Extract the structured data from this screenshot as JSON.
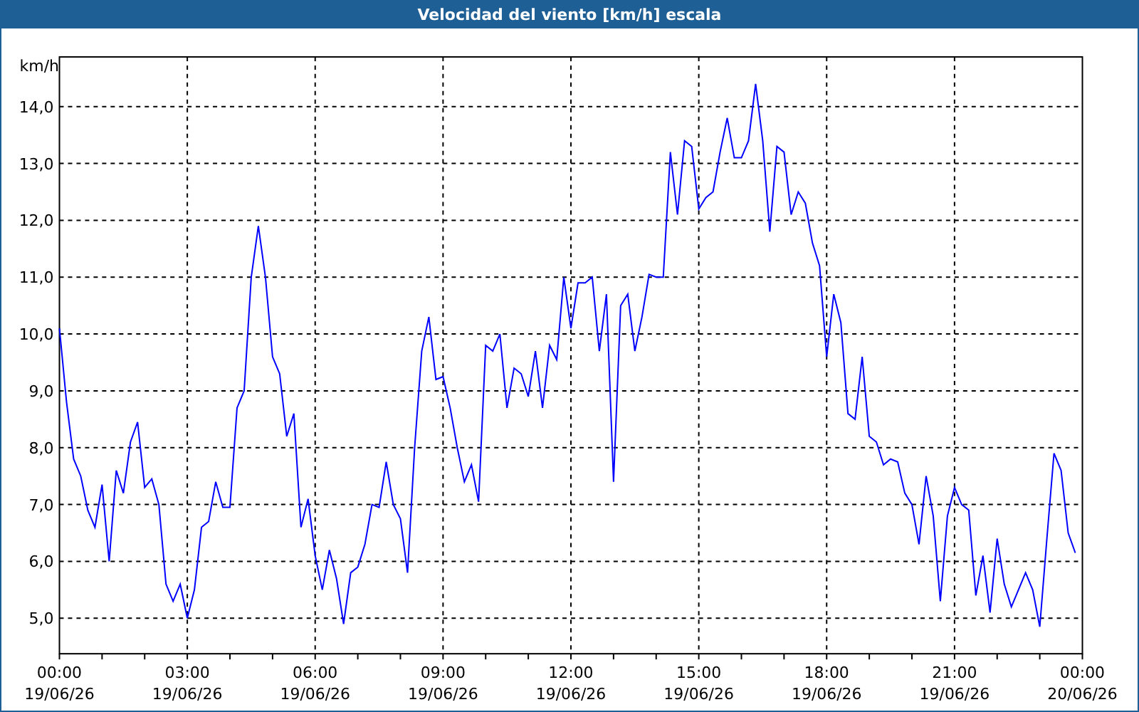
{
  "window": {
    "title": "Velocidad del viento [km/h] escala"
  },
  "chart_data": {
    "type": "line",
    "ylabel": "km/h",
    "grid": true,
    "categories": [
      "00:00 19/06/26",
      null,
      null,
      null,
      null,
      null,
      null,
      null,
      null,
      null,
      null,
      null,
      null,
      null,
      null,
      null,
      null,
      null,
      "03:00 19/06/26",
      null,
      null,
      null,
      null,
      null,
      null,
      null,
      null,
      null,
      null,
      null,
      null,
      null,
      null,
      null,
      null,
      null,
      "06:00 19/06/26",
      null,
      null,
      null,
      null,
      null,
      null,
      null,
      null,
      null,
      null,
      null,
      null,
      null,
      null,
      null,
      null,
      null,
      "09:00 19/06/26",
      null,
      null,
      null,
      null,
      null,
      null,
      null,
      null,
      null,
      null,
      null,
      null,
      null,
      null,
      null,
      null,
      null,
      "12:00 19/06/26",
      null,
      null,
      null,
      null,
      null,
      null,
      null,
      null,
      null,
      null,
      null,
      null,
      null,
      null,
      null,
      null,
      null,
      "15:00 19/06/26",
      null,
      null,
      null,
      null,
      null,
      null,
      null,
      null,
      null,
      null,
      null,
      null,
      null,
      null,
      null,
      null,
      null,
      "18:00 19/06/26",
      null,
      null,
      null,
      null,
      null,
      null,
      null,
      null,
      null,
      null,
      null,
      null,
      null,
      null,
      null,
      null,
      null,
      "21:00 19/06/26",
      null,
      null,
      null,
      null,
      null,
      null,
      null,
      null,
      null,
      null,
      null,
      null,
      null,
      null,
      null,
      null,
      null,
      "00:00 20/06/26"
    ],
    "series": [
      {
        "color": "#0000ff",
        "values": [
          10.1,
          8.8,
          7.8,
          7.5,
          6.9,
          6.6,
          7.35,
          6.0,
          7.6,
          7.2,
          8.1,
          8.45,
          7.3,
          7.45,
          7.0,
          5.6,
          5.3,
          5.6,
          5.0,
          5.5,
          6.6,
          6.7,
          7.4,
          6.95,
          6.95,
          8.7,
          9.0,
          11.0,
          11.9,
          11.0,
          9.6,
          9.3,
          8.2,
          8.6,
          6.6,
          7.1,
          6.1,
          5.5,
          6.2,
          5.7,
          4.9,
          5.8,
          5.9,
          6.3,
          7.0,
          6.95,
          7.75,
          7.0,
          6.75,
          5.8,
          8.0,
          9.7,
          10.3,
          9.2,
          9.25,
          8.7,
          8.0,
          7.4,
          7.7,
          7.05,
          9.8,
          9.7,
          10.0,
          8.7,
          9.4,
          9.3,
          8.9,
          9.7,
          8.7,
          9.8,
          9.55,
          11.0,
          10.1,
          10.9,
          10.9,
          11.0,
          9.7,
          10.7,
          7.4,
          10.5,
          10.7,
          9.7,
          10.3,
          11.05,
          11.0,
          11.0,
          13.2,
          12.1,
          13.4,
          13.3,
          12.2,
          12.4,
          12.5,
          13.2,
          13.8,
          13.1,
          13.1,
          13.4,
          14.4,
          13.4,
          11.8,
          13.3,
          13.2,
          12.1,
          12.5,
          12.3,
          11.6,
          11.2,
          9.6,
          10.7,
          10.2,
          8.6,
          8.5,
          9.6,
          8.2,
          8.1,
          7.7,
          7.8,
          7.75,
          7.2,
          7.0,
          6.3,
          7.5,
          6.8,
          5.3,
          6.8,
          7.3,
          7.0,
          6.9,
          5.4,
          6.1,
          5.1,
          6.4,
          5.6,
          5.2,
          5.5,
          5.8,
          5.5,
          4.85,
          6.4,
          7.9,
          7.6,
          6.5,
          6.15,
          null
        ]
      }
    ],
    "ylim": [
      4.375,
      14.875
    ],
    "yticks": [
      {
        "value": 5,
        "label": "5,0"
      },
      {
        "value": 6,
        "label": "6,0"
      },
      {
        "value": 7,
        "label": "7,0"
      },
      {
        "value": 8,
        "label": "8,0"
      },
      {
        "value": 9,
        "label": "9,0"
      },
      {
        "value": 10,
        "label": "10,0"
      },
      {
        "value": 11,
        "label": "11,0"
      },
      {
        "value": 12,
        "label": "12,0"
      },
      {
        "value": 13,
        "label": "13,0"
      },
      {
        "value": 14,
        "label": "14,0"
      }
    ]
  }
}
